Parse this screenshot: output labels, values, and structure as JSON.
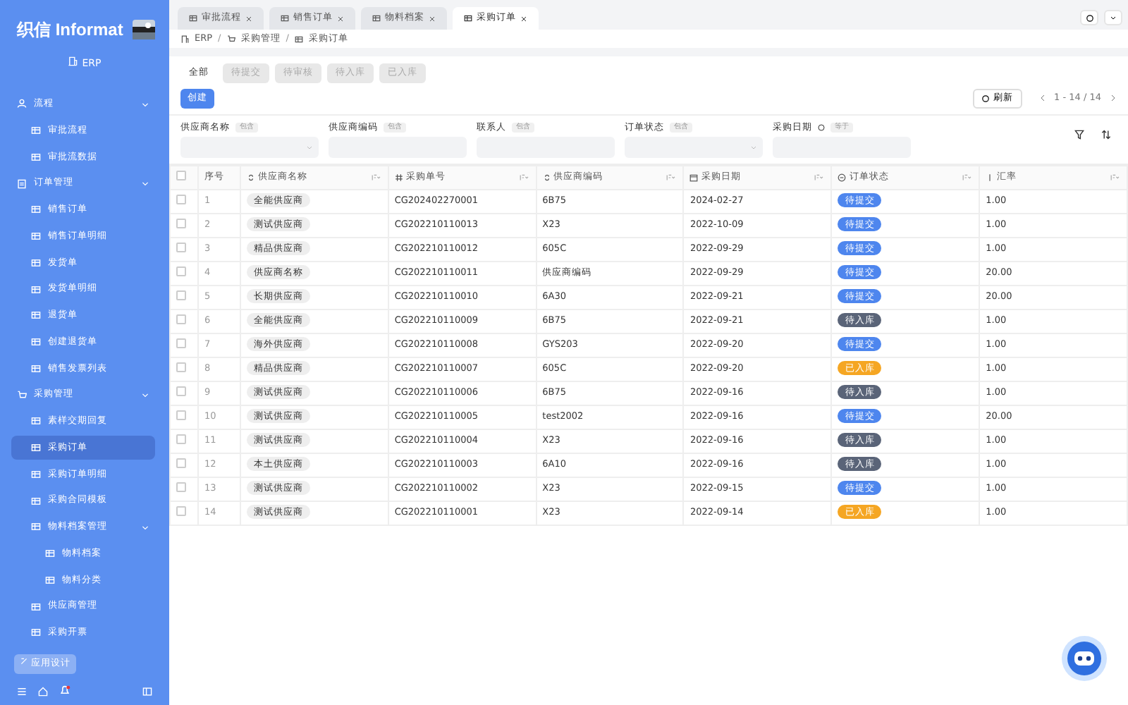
{
  "brand": {
    "title": "织信 Informat",
    "app": "ERP"
  },
  "sidebar": {
    "items": [
      {
        "label": "流程",
        "expanded": true,
        "selected": false,
        "children": [
          {
            "label": "审批流程",
            "selected": false
          },
          {
            "label": "审批流数据",
            "selected": false
          }
        ]
      },
      {
        "label": "订单管理",
        "expanded": true,
        "selected": false,
        "children": [
          {
            "label": "销售订单",
            "selected": false
          },
          {
            "label": "销售订单明细",
            "selected": false
          },
          {
            "label": "发货单",
            "selected": false
          },
          {
            "label": "发货单明细",
            "selected": false
          },
          {
            "label": "退货单",
            "selected": false
          },
          {
            "label": "创建退货单",
            "selected": false
          },
          {
            "label": "销售发票列表",
            "selected": false
          }
        ]
      },
      {
        "label": "采购管理",
        "expanded": true,
        "selected": false,
        "children": [
          {
            "label": "素样交期回复",
            "selected": false
          },
          {
            "label": "采购订单",
            "selected": true
          },
          {
            "label": "采购订单明细",
            "selected": false
          },
          {
            "label": "采购合同模板",
            "selected": false
          },
          {
            "label": "物料档案管理",
            "expanded": true,
            "selected": false,
            "children": [
              {
                "label": "物料档案",
                "selected": false
              },
              {
                "label": "物料分类",
                "selected": false
              }
            ]
          },
          {
            "label": "供应商管理",
            "selected": false
          },
          {
            "label": "采购开票",
            "selected": false
          }
        ]
      }
    ],
    "design_button": "应用设计"
  },
  "tabs": [
    {
      "label": "审批流程",
      "selected": false
    },
    {
      "label": "销售订单",
      "selected": false
    },
    {
      "label": "物料档案",
      "selected": false
    },
    {
      "label": "采购订单",
      "selected": true
    }
  ],
  "breadcrumb": {
    "separator": "/",
    "items": [
      "ERP",
      "采购管理",
      "采购订单"
    ]
  },
  "select_all_checked": false,
  "status_tabs": [
    {
      "label": "全部",
      "selected": true
    },
    {
      "label": "待提交",
      "selected": false
    },
    {
      "label": "待审核",
      "selected": false
    },
    {
      "label": "待入库",
      "selected": false
    },
    {
      "label": "已入库",
      "selected": false
    }
  ],
  "create_button": "创建",
  "refresh_button": "刷新",
  "pagination": "1 - 14 / 14",
  "filters": [
    {
      "label": "供应商名称",
      "op": "包含",
      "kind": "select"
    },
    {
      "label": "供应商编码",
      "op": "包含",
      "kind": "text"
    },
    {
      "label": "联系人",
      "op": "包含",
      "kind": "text"
    },
    {
      "label": "订单状态",
      "op": "包含",
      "kind": "select"
    },
    {
      "label": "采购日期",
      "op": "等于",
      "kind": "date"
    }
  ],
  "table": {
    "columns": [
      "序号",
      "供应商名称",
      "采购单号",
      "供应商编码",
      "采购日期",
      "订单状态",
      "汇率"
    ],
    "rows": [
      {
        "checked": false,
        "no": "1",
        "supplier": "全能供应商",
        "order": "CG202402270001",
        "code": "6B75",
        "date": "2024-02-27",
        "status": "待提交",
        "color": "#4e86ee",
        "rate": "1.00"
      },
      {
        "checked": false,
        "no": "2",
        "supplier": "测试供应商",
        "order": "CG202210110013",
        "code": "X23",
        "date": "2022-10-09",
        "status": "待提交",
        "color": "#4e86ee",
        "rate": "1.00"
      },
      {
        "checked": false,
        "no": "3",
        "supplier": "精品供应商",
        "order": "CG202210110012",
        "code": "605C",
        "date": "2022-09-29",
        "status": "待提交",
        "color": "#4e86ee",
        "rate": "1.00"
      },
      {
        "checked": false,
        "no": "4",
        "supplier": "供应商名称",
        "order": "CG202210110011",
        "code": "供应商编码",
        "date": "2022-09-29",
        "status": "待提交",
        "color": "#4e86ee",
        "rate": "20.00"
      },
      {
        "checked": false,
        "no": "5",
        "supplier": "长期供应商",
        "order": "CG202210110010",
        "code": "6A30",
        "date": "2022-09-21",
        "status": "待提交",
        "color": "#4e86ee",
        "rate": "20.00"
      },
      {
        "checked": false,
        "no": "6",
        "supplier": "全能供应商",
        "order": "CG202210110009",
        "code": "6B75",
        "date": "2022-09-21",
        "status": "待入库",
        "color": "#5a6478",
        "rate": "1.00"
      },
      {
        "checked": false,
        "no": "7",
        "supplier": "海外供应商",
        "order": "CG202210110008",
        "code": "GYS203",
        "date": "2022-09-20",
        "status": "待提交",
        "color": "#4e86ee",
        "rate": "1.00"
      },
      {
        "checked": false,
        "no": "8",
        "supplier": "精品供应商",
        "order": "CG202210110007",
        "code": "605C",
        "date": "2022-09-20",
        "status": "已入库",
        "color": "#f5a623",
        "rate": "1.00"
      },
      {
        "checked": false,
        "no": "9",
        "supplier": "测试供应商",
        "order": "CG202210110006",
        "code": "6B75",
        "date": "2022-09-16",
        "status": "待入库",
        "color": "#5a6478",
        "rate": "1.00"
      },
      {
        "checked": false,
        "no": "10",
        "supplier": "测试供应商",
        "order": "CG202210110005",
        "code": "test2002",
        "date": "2022-09-16",
        "status": "待提交",
        "color": "#4e86ee",
        "rate": "20.00"
      },
      {
        "checked": false,
        "no": "11",
        "supplier": "测试供应商",
        "order": "CG202210110004",
        "code": "X23",
        "date": "2022-09-16",
        "status": "待入库",
        "color": "#5a6478",
        "rate": "1.00"
      },
      {
        "checked": false,
        "no": "12",
        "supplier": "本土供应商",
        "order": "CG202210110003",
        "code": "6A10",
        "date": "2022-09-16",
        "status": "待入库",
        "color": "#5a6478",
        "rate": "1.00"
      },
      {
        "checked": false,
        "no": "13",
        "supplier": "测试供应商",
        "order": "CG202210110002",
        "code": "X23",
        "date": "2022-09-15",
        "status": "待提交",
        "color": "#4e86ee",
        "rate": "1.00"
      },
      {
        "checked": false,
        "no": "14",
        "supplier": "测试供应商",
        "order": "CG202210110001",
        "code": "X23",
        "date": "2022-09-14",
        "status": "已入库",
        "color": "#f5a623",
        "rate": "1.00"
      }
    ]
  }
}
